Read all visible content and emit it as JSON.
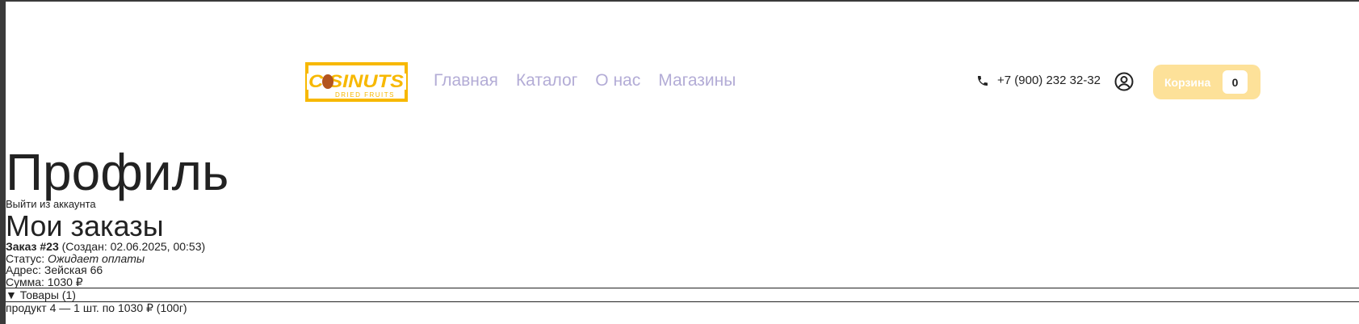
{
  "header": {
    "logo_text": "COSINUTS",
    "logo_subtext": "DRIED FRUITS",
    "nav": [
      "Главная",
      "Каталог",
      "О нас",
      "Магазины"
    ],
    "phone": "+7 (900) 232 32-32",
    "cart_label": "Корзина",
    "cart_count": "0"
  },
  "profile": {
    "title": "Профиль",
    "logout": "Выйти из аккаунта",
    "orders_title": "Мои заказы"
  },
  "order": {
    "number": "Заказ #23",
    "created": "(Создан: 02.06.2025, 00:53)",
    "status_label": "Статус:",
    "status_value": "Ожидает оплаты",
    "address": "Адрес: Зейская 66",
    "sum": "Сумма: 1030 ₽",
    "items_toggle": "▼ Товары (1)",
    "items": [
      "продукт 4 — 1 шт. по 1030 ₽ (100г)"
    ]
  },
  "colors": {
    "nav_link": "#b3acd6",
    "logo": "#f7b800",
    "cart_bg": "#fde199"
  }
}
